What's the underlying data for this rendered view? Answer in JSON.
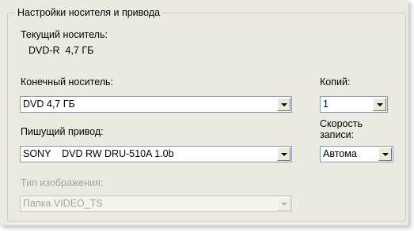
{
  "group": {
    "title": "Настройки носителя и привода",
    "current_media_label": "Текущий носитель:",
    "current_media_value": "DVD-R  4,7 ГБ",
    "target_media_label": "Конечный носитель:",
    "target_media_value": "DVD 4,7 ГБ",
    "copies_label": "Копий:",
    "copies_value": "1",
    "writer_label": "Пишущий привод:",
    "writer_value": "SONY    DVD RW DRU-510A 1.0b",
    "speed_label_line1": "Скорость",
    "speed_label_line2": "записи:",
    "speed_value": "Автома",
    "image_type_label": "Тип изображения:",
    "image_type_value": "Папка VIDEO_TS",
    "image_type_disabled": true
  },
  "icons": {
    "dropdown": "chevron-down-icon"
  },
  "colors": {
    "panel_bg": "#eceae0",
    "field_border": "#7f9db9",
    "disabled_text": "#a7a699"
  }
}
